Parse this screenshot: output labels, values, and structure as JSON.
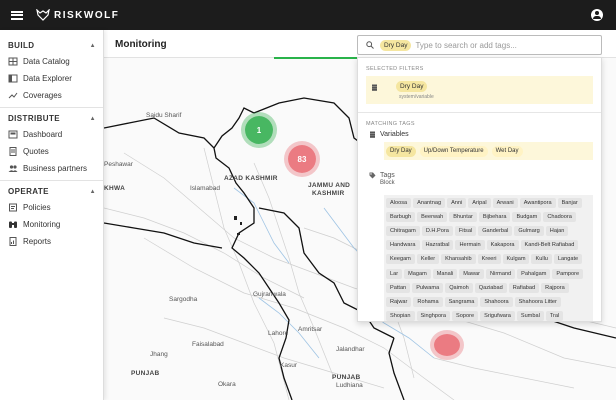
{
  "app": {
    "brand": "RISKWOLF"
  },
  "sidebar": {
    "sections": [
      {
        "title": "BUILD",
        "items": [
          {
            "label": "Data Catalog",
            "icon": "grid-icon"
          },
          {
            "label": "Data Explorer",
            "icon": "table-icon"
          },
          {
            "label": "Coverages",
            "icon": "chart-line-icon"
          }
        ]
      },
      {
        "title": "DISTRIBUTE",
        "items": [
          {
            "label": "Dashboard",
            "icon": "dashboard-icon"
          },
          {
            "label": "Quotes",
            "icon": "document-icon"
          },
          {
            "label": "Business partners",
            "icon": "people-icon"
          }
        ]
      },
      {
        "title": "OPERATE",
        "items": [
          {
            "label": "Policies",
            "icon": "policy-icon"
          },
          {
            "label": "Monitoring",
            "icon": "binoculars-icon"
          },
          {
            "label": "Reports",
            "icon": "report-icon"
          }
        ]
      }
    ]
  },
  "main": {
    "title": "Monitoring"
  },
  "search": {
    "chip": "Dry Day",
    "placeholder": "Type to search or add tags..."
  },
  "dropdown": {
    "selected_heading": "SELECTED FILTERS",
    "selected": {
      "label": "Dry Day",
      "sub": "system/variable"
    },
    "matching_heading": "MATCHING TAGS",
    "variables_label": "Variables",
    "variables": [
      "Dry Day",
      "Up/Down Temperature",
      "Wet Day"
    ],
    "tags_label": "Tags",
    "tags_sub": "Block",
    "tags": [
      "Aloosa",
      "Anantnag",
      "Anni",
      "Aripal",
      "Arwani",
      "Awantipora",
      "Banjar",
      "Barbugh",
      "Beerwah",
      "Bhuntar",
      "Bijbehara",
      "Budgam",
      "Chadoora",
      "Chitragam",
      "D.H.Pora",
      "Fitsal",
      "Ganderbal",
      "Gulmarg",
      "Hajan",
      "Handwara",
      "Hazratbal",
      "Hermain",
      "Kakapora",
      "Kandi-Belt Rafiabad",
      "Keegam",
      "Keller",
      "Khansahib",
      "Kreeri",
      "Kulgam",
      "Kullu",
      "Langate",
      "Lar",
      "Magam",
      "Manali",
      "Mawar",
      "Nirmand",
      "Pahalgam",
      "Pampore",
      "Pattan",
      "Pulwama",
      "Qaimoh",
      "Qaziabad",
      "Rafiabad",
      "Rajpora",
      "Rajwar",
      "Rohama",
      "Sangrama",
      "Shahoora",
      "Shahoora Litter",
      "Shopian",
      "Singhpora",
      "Sopore",
      "Srigufwara",
      "Sumbal",
      "Tral"
    ]
  },
  "map": {
    "clusters": [
      {
        "count": "1",
        "color": "#28aa46"
      },
      {
        "count": "83",
        "color": "#e6505a"
      }
    ],
    "labels": [
      "Saidu Sharif",
      "Peshawar",
      "KHWA",
      "Islamabad",
      "AZAD KASHMIR",
      "JAMMU AND",
      "KASHMIR",
      "Gujranwala",
      "Sargodha",
      "Faisalabad",
      "Lahore",
      "Amritsar",
      "Jhang",
      "PUNJAB",
      "Okara",
      "Kasur",
      "Jalandhar",
      "Ludhiana",
      "PUNJAB"
    ]
  }
}
